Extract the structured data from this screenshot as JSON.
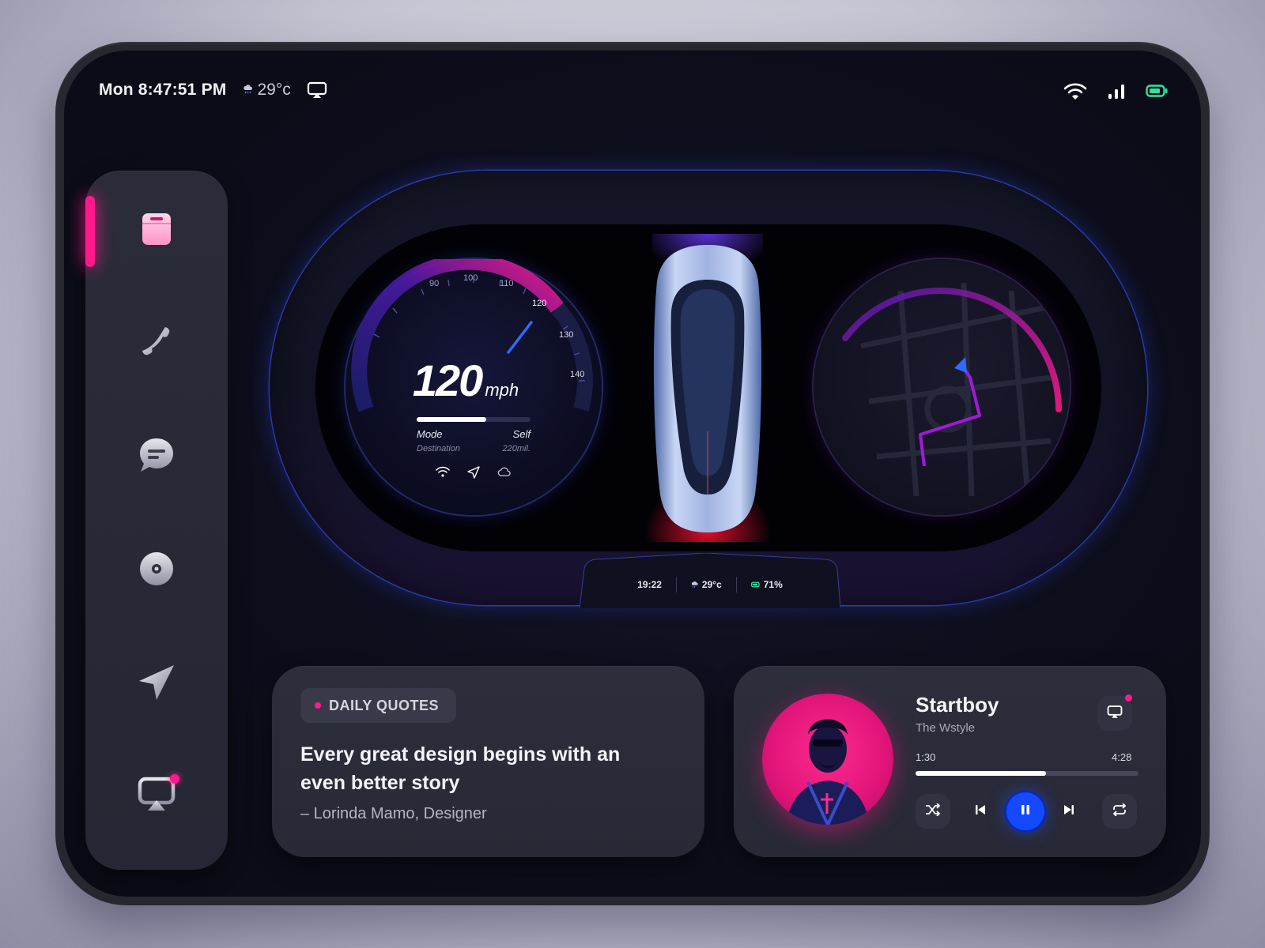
{
  "status_bar": {
    "datetime": "Mon 8:47:51 PM",
    "temperature": "29°c",
    "weather_icon": "rain-cloud-icon",
    "right_icons": [
      "wifi-icon",
      "signal-icon",
      "battery-icon"
    ],
    "battery_color": "#2ee59d"
  },
  "sidebar": {
    "active_index": 0,
    "accent_color": "#ff1a8c",
    "items": [
      {
        "name": "dashboard",
        "icon": "card-icon"
      },
      {
        "name": "phone",
        "icon": "phone-icon"
      },
      {
        "name": "messages",
        "icon": "chat-icon"
      },
      {
        "name": "music",
        "icon": "disc-icon"
      },
      {
        "name": "navigation",
        "icon": "navigation-arrow-icon"
      },
      {
        "name": "cast",
        "icon": "cast-icon",
        "notification": true
      }
    ]
  },
  "speedometer": {
    "speed": "120",
    "unit": "mph",
    "ticks": [
      "90",
      "100",
      "110",
      "120",
      "130",
      "140"
    ],
    "progress": 0.61,
    "mode_label": "Mode",
    "mode_value": "Self",
    "destination_label": "Destination",
    "destination_value": "220mil.",
    "icons": [
      "wifi-icon",
      "navigation-icon",
      "cloud-icon"
    ]
  },
  "cluster_footer": {
    "time": "19:22",
    "temperature": "29°c",
    "battery": "71%"
  },
  "quote": {
    "badge": "DAILY QUOTES",
    "text": "Every great design begins with an even better story",
    "author": "– Lorinda Mamo, Designer"
  },
  "player": {
    "title": "Startboy",
    "artist": "The Wstyle",
    "elapsed": "1:30",
    "duration": "4:28",
    "progress": 0.586,
    "accent_color": "#1549ff",
    "controls": [
      "shuffle-icon",
      "previous-icon",
      "pause-icon",
      "next-icon",
      "repeat-icon"
    ]
  }
}
